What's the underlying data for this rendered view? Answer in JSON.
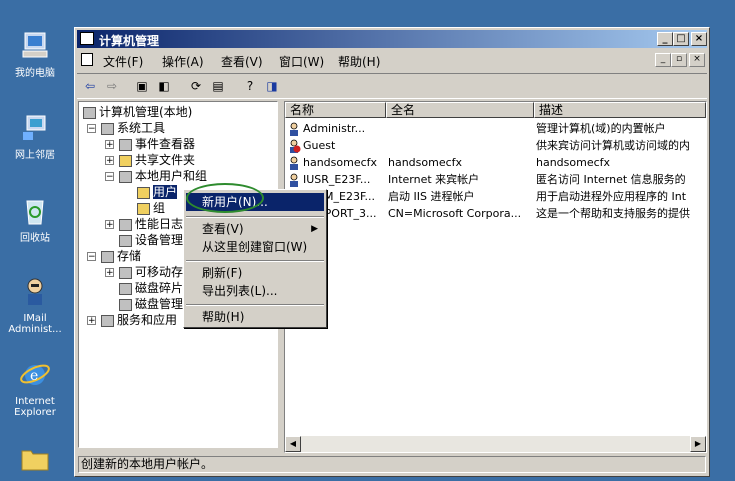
{
  "desktop": {
    "icons": [
      {
        "label": "我的电脑"
      },
      {
        "label": "网上邻居"
      },
      {
        "label": "回收站"
      },
      {
        "label_line1": "IMail",
        "label_line2": "Administ..."
      },
      {
        "label_line1": "Internet",
        "label_line2": "Explorer"
      }
    ]
  },
  "window": {
    "title": "计算机管理",
    "menu": [
      "文件(F)",
      "操作(A)",
      "查看(V)",
      "窗口(W)",
      "帮助(H)"
    ]
  },
  "tree": {
    "items": [
      "计算机管理(本地)",
      "系统工具",
      "事件查看器",
      "共享文件夹",
      "本地用户和组",
      "用户",
      "组",
      "性能日志",
      "设备管理",
      "存储",
      "可移动存",
      "磁盘碎片",
      "磁盘管理",
      "服务和应用"
    ]
  },
  "list": {
    "columns": [
      "名称",
      "全名",
      "描述"
    ],
    "rows": [
      {
        "name": "Administr...",
        "fullname": "",
        "desc": "管理计算机(域)的内置帐户"
      },
      {
        "name": "Guest",
        "fullname": "",
        "desc": "供来宾访问计算机或访问域的内"
      },
      {
        "name": "handsomecfx",
        "fullname": "handsomecfx",
        "desc": "handsomecfx"
      },
      {
        "name": "IUSR_E23F...",
        "fullname": "Internet 来宾帐户",
        "desc": "匿名访问 Internet 信息服务的"
      },
      {
        "name": "IWAM_E23F...",
        "fullname": "启动 IIS 进程帐户",
        "desc": "用于启动进程外应用程序的 Int"
      },
      {
        "name": "SUPPORT_3...",
        "fullname": "CN=Microsoft Corpora...",
        "desc": "这是一个帮助和支持服务的提供"
      }
    ]
  },
  "context_menu": {
    "items": [
      "新用户(N)...",
      "查看(V)",
      "从这里创建窗口(W)",
      "刷新(F)",
      "导出列表(L)...",
      "帮助(H)"
    ]
  },
  "status": {
    "text": "创建新的本地用户帐户。"
  }
}
